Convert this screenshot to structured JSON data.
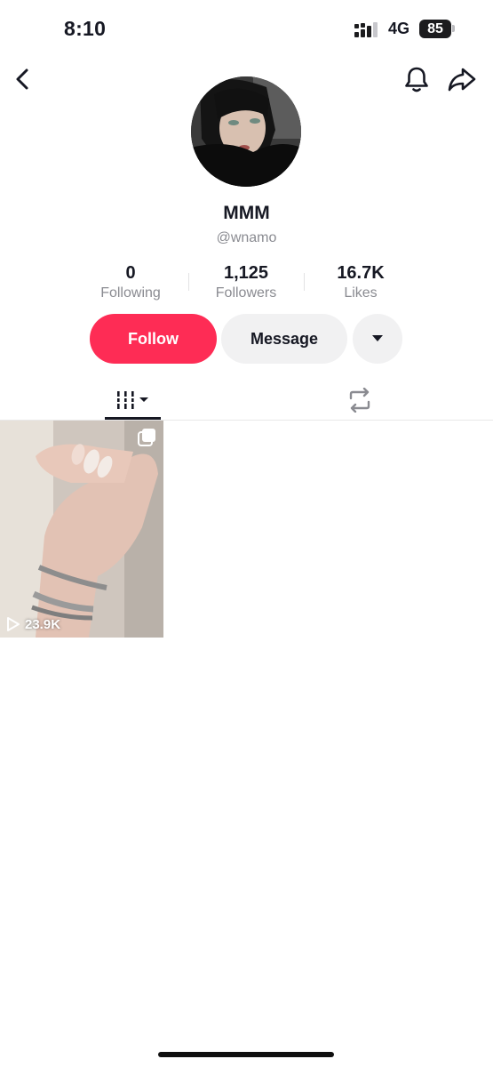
{
  "status_bar": {
    "time": "8:10",
    "network": "4G",
    "battery": "85"
  },
  "nav": {
    "back_icon": "chevron-left-icon",
    "bell_icon": "bell-icon",
    "share_icon": "share-arrow-icon"
  },
  "profile": {
    "name": "MMM",
    "handle": "@wnamo"
  },
  "stats": [
    {
      "value": "0",
      "label": "Following"
    },
    {
      "value": "1,125",
      "label": "Followers"
    },
    {
      "value": "16.7K",
      "label": "Likes"
    }
  ],
  "actions": {
    "follow_label": "Follow",
    "message_label": "Message"
  },
  "videos": [
    {
      "views": "23.9K"
    }
  ],
  "colors": {
    "accent": "#fe2c55",
    "secondary_button": "#f1f1f2",
    "muted_text": "#8a8b91"
  }
}
